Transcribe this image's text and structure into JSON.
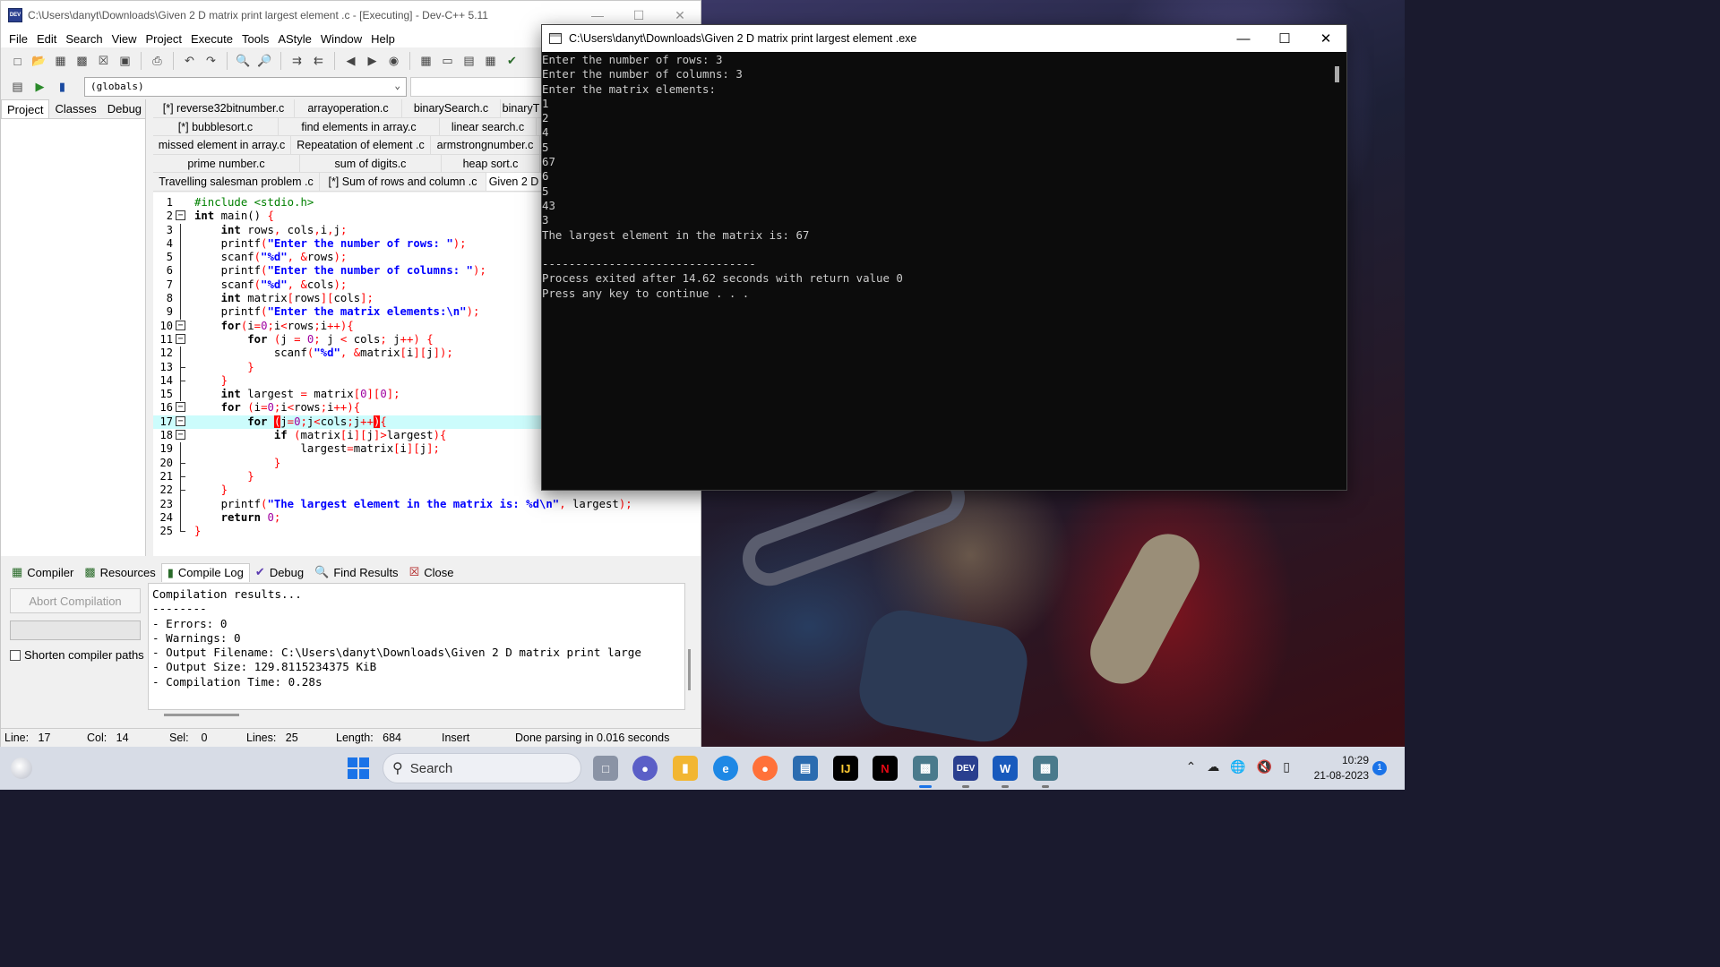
{
  "devcpp": {
    "title": "C:\\Users\\danyt\\Downloads\\Given 2 D matrix print largest element .c - [Executing] - Dev-C++ 5.11",
    "menu": [
      "File",
      "Edit",
      "Search",
      "View",
      "Project",
      "Execute",
      "Tools",
      "AStyle",
      "Window",
      "Help"
    ],
    "globals_select": "(globals)",
    "left_tabs": [
      "Project",
      "Classes",
      "Debug"
    ],
    "file_tabs": [
      [
        "[*] reverse32bitnumber.c",
        "arrayoperation.c",
        "binarySearch.c",
        "binaryT"
      ],
      [
        "[*] bubblesort.c",
        "find elements in array.c",
        "linear search.c"
      ],
      [
        "missed element in array.c",
        "Repeatation of element .c",
        "armstrongnumber.c"
      ],
      [
        "prime number.c",
        "sum of digits.c",
        "heap sort.c"
      ],
      [
        "Travelling salesman problem .c",
        "[*] Sum of rows and column .c",
        "Given 2 D"
      ]
    ],
    "bottom_tabs": [
      "Compiler",
      "Resources",
      "Compile Log",
      "Debug",
      "Find Results",
      "Close"
    ],
    "abort_button": "Abort Compilation",
    "shorten_label": "Shorten compiler paths",
    "compile_log": [
      "Compilation results...",
      "--------",
      "- Errors: 0",
      "- Warnings: 0",
      "- Output Filename: C:\\Users\\danyt\\Downloads\\Given 2 D matrix print large",
      "- Output Size: 129.8115234375 KiB",
      "- Compilation Time: 0.28s"
    ],
    "status": {
      "line_label": "Line:",
      "line": "17",
      "col_label": "Col:",
      "col": "14",
      "sel_label": "Sel:",
      "sel": "0",
      "lines_label": "Lines:",
      "lines": "25",
      "length_label": "Length:",
      "length": "684",
      "mode": "Insert",
      "message": "Done parsing in 0.016 seconds"
    }
  },
  "code_lines": [
    "1",
    "2",
    "3",
    "4",
    "5",
    "6",
    "7",
    "8",
    "9",
    "10",
    "11",
    "12",
    "13",
    "14",
    "15",
    "16",
    "17",
    "18",
    "19",
    "20",
    "21",
    "22",
    "23",
    "24",
    "25"
  ],
  "console": {
    "title": "C:\\Users\\danyt\\Downloads\\Given 2 D matrix print largest element .exe",
    "lines": [
      "Enter the number of rows: 3",
      "Enter the number of columns: 3",
      "Enter the matrix elements:",
      "1",
      "2",
      "4",
      "5",
      "67",
      "6",
      "5",
      "43",
      "3",
      "The largest element in the matrix is: 67",
      "",
      "--------------------------------",
      "Process exited after 14.62 seconds with return value 0",
      "Press any key to continue . . ."
    ]
  },
  "taskbar": {
    "search_label": "Search",
    "time": "10:29",
    "date": "21-08-2023",
    "notification_count": "1"
  }
}
